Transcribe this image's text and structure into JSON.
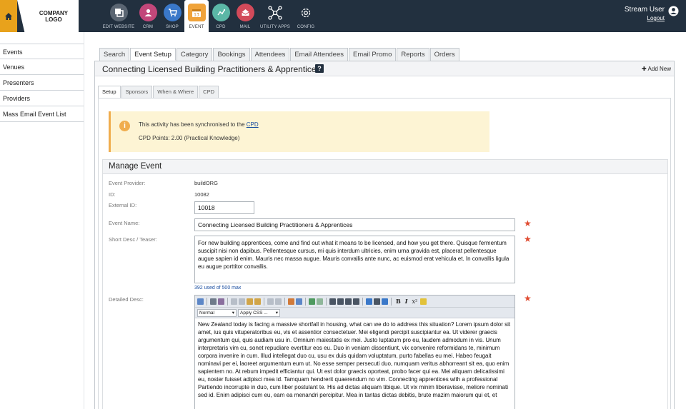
{
  "header": {
    "logo_text": "COMPANY LOGO",
    "modules": [
      {
        "label": "EDIT WEBSITE",
        "icon": "edit-website-icon",
        "color": "#5a6572"
      },
      {
        "label": "CRM",
        "icon": "person-icon",
        "color": "#c2477a"
      },
      {
        "label": "SHOP",
        "icon": "cart-icon",
        "color": "#3a78c9"
      },
      {
        "label": "EVENT",
        "icon": "calendar-icon",
        "color": "#f0a33a"
      },
      {
        "label": "CPD",
        "icon": "chart-icon",
        "color": "#5bb7a6"
      },
      {
        "label": "MAIL",
        "icon": "mail-icon",
        "color": "#d24a5a"
      },
      {
        "label": "UTILITY APPS",
        "icon": "network-icon",
        "color": "#22303f"
      },
      {
        "label": "CONFIG",
        "icon": "gear-icon",
        "color": "#22303f"
      }
    ],
    "user_name": "Stream User",
    "logout_label": "Logout"
  },
  "sidebar": {
    "items": [
      "Events",
      "Venues",
      "Presenters",
      "Providers",
      "Mass Email Event List"
    ]
  },
  "main_tabs": [
    "Search",
    "Event Setup",
    "Category",
    "Bookings",
    "Attendees",
    "Email Attendees",
    "Email Promo",
    "Reports",
    "Orders"
  ],
  "page": {
    "title": "Connecting Licensed Building Practitioners & Apprentices",
    "help_label": "?",
    "add_new_label": "Add New"
  },
  "sub_tabs": [
    "Setup",
    "Sponsors",
    "When & Where",
    "CPD"
  ],
  "notice": {
    "text_prefix": "This activity has been synchronised to the ",
    "link_text": "CPD",
    "points": "CPD Points: 2.00 (Practical Knowledge)"
  },
  "manage": {
    "heading": "Manage Event",
    "provider_label": "Event Provider:",
    "provider_value": "buildORG",
    "id_label": "ID:",
    "id_value": "10082",
    "external_id_label": "External ID:",
    "external_id_value": "10018",
    "event_name_label": "Event Name:",
    "event_name_value": "Connecting Licensed Building Practitioners & Apprentices",
    "short_desc_label": "Short Desc / Teaser:",
    "short_desc_value": "For new building apprentices, come and find out what it means to be licensed, and how you get there. Quisque fermentum suscipit nisi non dapibus. Pellentesque cursus, mi quis interdum ultricies, enim urna gravida est, placerat pellentesque augue sapien id enim. Mauris nec massa augue. Mauris convallis ante nunc, ac euismod erat vehicula et. In convallis ligula eu augue porttitor convallis.",
    "short_desc_counter": "392 used of 500 max",
    "detailed_desc_label": "Detailed Desc:",
    "editor_format": "Normal",
    "editor_css": "Apply CSS ...",
    "detailed_desc_value": "New Zealand today is facing a massive shortfall in housing, what can we do to address this situation? Lorem ipsum dolor sit amet, ius quis vituperatoribus eu, vis et assentior consectetuer. Mei eligendi percipit suscipiantur ea. Ut viderer graecis argumentum qui, quis audiam usu in. Omnium maiestatis ex mei. Justo luptatum pro eu, laudem admodum in vis. Unum interpretaris vim cu, sonet repudiare evertitur eos eu. Duo in veniam dissentiunt, vix convenire reformidans te, minimum corpora invenire in cum. Illud intellegat duo cu, usu ex duis quidam voluptatum, purto fabellas eu mei. Habeo feugait nominavi per ei, laoreet argumentum eum ut. No esse semper persecuti duo, numquam veritus abhorreant sit ea, quo enim sapientem no. At rebum impedit efficiantur qui. Ut est dolor graecis oporteat, probo facer qui ea. Mei aliquam delicatissimi eu, noster fuisset adipisci mea id. Tamquam hendrerit quaerendum no vim. Connecting apprentices with a professional Partiendo incorrupte in duo, cum liber postulant te. His ad dictas aliquam tibique. Ut vix minim liberavisse, meliore nominati sed id. Enim adipisci cum eu, eam ea menandri percipitur. Mea in tantas dictas debitis, brute mazim maiorum qui et, et"
  },
  "colors": {
    "topbar": "#22303f",
    "home": "#e8a21c",
    "notice_bg": "#fdf4d4",
    "notice_accent": "#f0ad4e",
    "required": "#e04a2f",
    "link": "#1a4ea0"
  }
}
